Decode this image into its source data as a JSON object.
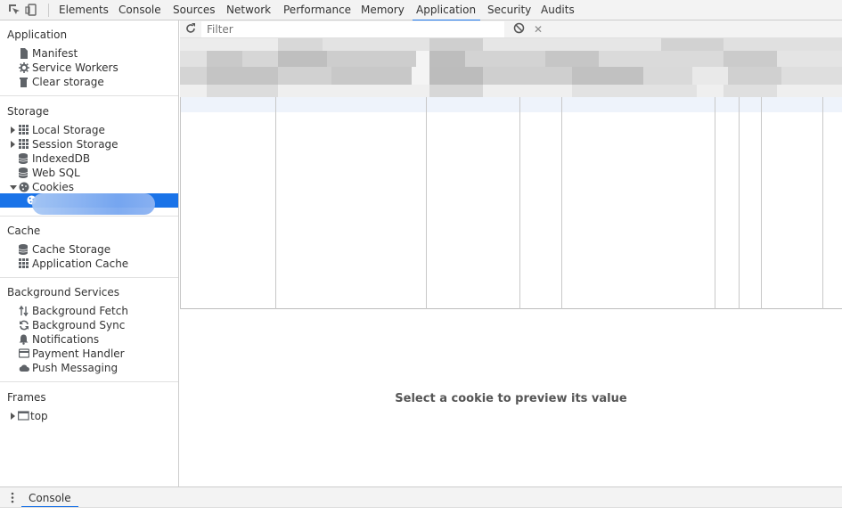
{
  "tabs": [
    {
      "label": "Elements",
      "active": false
    },
    {
      "label": "Console",
      "active": false
    },
    {
      "label": "Sources",
      "active": false
    },
    {
      "label": "Network",
      "active": false
    },
    {
      "label": "Performance",
      "active": false
    },
    {
      "label": "Memory",
      "active": false
    },
    {
      "label": "Application",
      "active": true
    },
    {
      "label": "Security",
      "active": false
    },
    {
      "label": "Audits",
      "active": false
    }
  ],
  "sidebar": {
    "application": {
      "title": "Application",
      "items": [
        {
          "label": "Manifest",
          "icon": "document-icon"
        },
        {
          "label": "Service Workers",
          "icon": "gear-icon"
        },
        {
          "label": "Clear storage",
          "icon": "trash-icon"
        }
      ]
    },
    "storage": {
      "title": "Storage",
      "items": [
        {
          "label": "Local Storage",
          "icon": "grid-icon",
          "expander": "collapsed"
        },
        {
          "label": "Session Storage",
          "icon": "grid-icon",
          "expander": "collapsed"
        },
        {
          "label": "IndexedDB",
          "icon": "database-icon"
        },
        {
          "label": "Web SQL",
          "icon": "database-icon"
        },
        {
          "label": "Cookies",
          "icon": "cookie-icon",
          "expander": "expanded"
        }
      ]
    },
    "cache": {
      "title": "Cache",
      "items": [
        {
          "label": "Cache Storage",
          "icon": "database-icon"
        },
        {
          "label": "Application Cache",
          "icon": "grid-icon"
        }
      ]
    },
    "background": {
      "title": "Background Services",
      "items": [
        {
          "label": "Background Fetch",
          "icon": "up-down-arrows-icon"
        },
        {
          "label": "Background Sync",
          "icon": "sync-icon"
        },
        {
          "label": "Notifications",
          "icon": "bell-icon"
        },
        {
          "label": "Payment Handler",
          "icon": "card-icon"
        },
        {
          "label": "Push Messaging",
          "icon": "cloud-icon"
        }
      ]
    },
    "frames": {
      "title": "Frames",
      "items": [
        {
          "label": "top",
          "icon": "frame-icon",
          "expander": "collapsed"
        }
      ]
    }
  },
  "toolbar": {
    "filter_placeholder": "Filter"
  },
  "preview": {
    "message": "Select a cookie to preview its value"
  },
  "drawer": {
    "tab_label": "Console"
  },
  "colors": {
    "accent": "#1a73e8",
    "selected_row": "#1a73e8",
    "toolbar_bg": "#f3f3f3"
  }
}
